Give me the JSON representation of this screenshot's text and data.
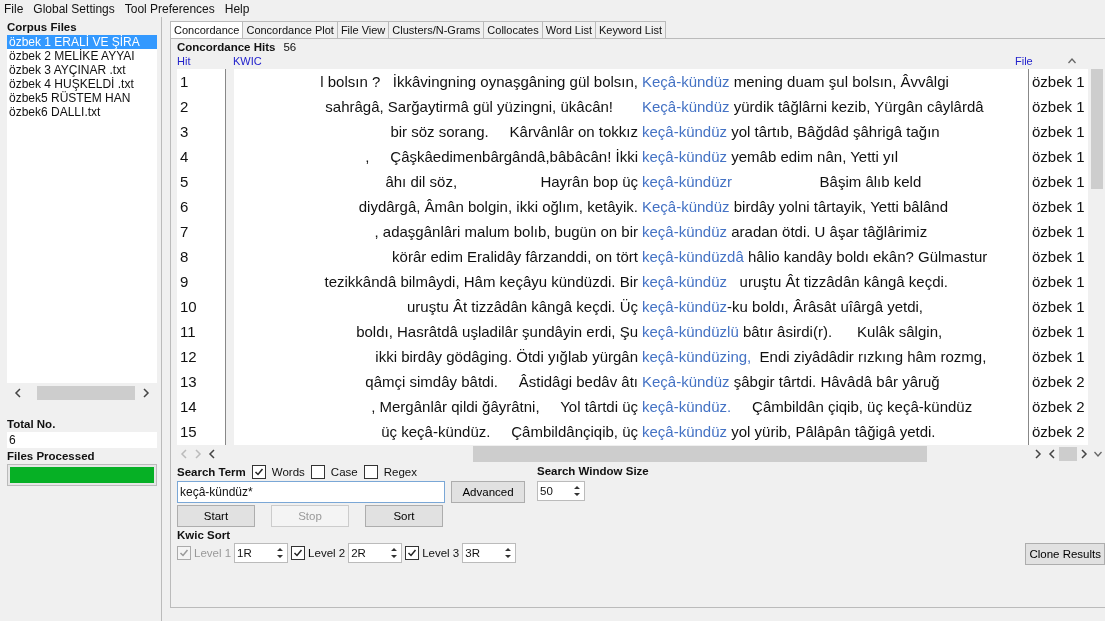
{
  "menu": [
    "File",
    "Global Settings",
    "Tool Preferences",
    "Help"
  ],
  "corpus": {
    "title": "Corpus Files",
    "files": [
      {
        "name": "özbek 1 ERALİ VE ŞİRA",
        "selected": true
      },
      {
        "name": "özbek 2 MELİKE AYYAI",
        "selected": false
      },
      {
        "name": "özbek 3 AYÇINAR .txt",
        "selected": false
      },
      {
        "name": "özbek 4 HUŞKELDİ .txt",
        "selected": false
      },
      {
        "name": "özbek5 RÜSTEM HAN",
        "selected": false
      },
      {
        "name": "özbek6 DALLI.txt",
        "selected": false
      }
    ],
    "total_label": "Total No.",
    "total": "6",
    "processed_label": "Files Processed",
    "progress": {
      "level": 1
    }
  },
  "tabs": [
    {
      "label": "Concordance",
      "selected": true
    },
    {
      "label": "Concordance Plot",
      "selected": false
    },
    {
      "label": "File View",
      "selected": false
    },
    {
      "label": "Clusters/N-Grams",
      "selected": false
    },
    {
      "label": "Collocates",
      "selected": false
    },
    {
      "label": "Word List",
      "selected": false
    },
    {
      "label": "Keyword List",
      "selected": false
    }
  ],
  "hits_label": "Concordance Hits",
  "hits": "56",
  "columns": {
    "hit": "Hit",
    "kwic": "KWIC",
    "file": "File"
  },
  "rows": [
    {
      "hit": "1",
      "left": "l bolsın ?   İkkâvingning oynaşgâning gül bolsın,",
      "key": "Keçâ-kündüz",
      "right": " mening duam şul bolsın, Âvvâlgi",
      "file": "özbek 1"
    },
    {
      "hit": "2",
      "left": "sahrâgâ, Sarğaytirmâ gül yüzingni, ükâcân!      ",
      "key": "Keçâ-kündüz",
      "right": " yürdik tâğlârni kezib, Yürgân câylârdâ",
      "file": "özbek 1"
    },
    {
      "hit": "3",
      "left": "bir söz sorang.     Kârvânlâr on tokkız",
      "key": "keçâ-kündüz",
      "right": " yol târtıb, Bâğdâd şâhrigâ tağın",
      "file": "özbek 1"
    },
    {
      "hit": "4",
      "left": ",     Çâşkâedimenbârgândâ,bâbâcân! İkki",
      "key": "keçâ-kündüz",
      "right": " yemâb edim nân, Yetti yıl",
      "file": "özbek 1"
    },
    {
      "hit": "5",
      "left": "âhı dil söz,                    Hayrân bop üç",
      "key": "keçâ-kündüzr",
      "right": "                     Bâşim âlıb keld",
      "file": "özbek 1"
    },
    {
      "hit": "6",
      "left": "diydârgâ, Âmân bolgin, ikki oğlım, ketâyik.",
      "key": "Keçâ-kündüz",
      "right": " birdây yolni târtayik, Yetti bâlând",
      "file": "özbek 1"
    },
    {
      "hit": "7",
      "left": ", adaşgânlâri malum bolıb, bugün on bir",
      "key": "keçâ-kündüz",
      "right": " aradan ötdi. U âşar tâğlârimiz",
      "file": "özbek 1"
    },
    {
      "hit": "8",
      "left": "körâr edim Eralidây fârzanddi, on tört",
      "key": "keçâ-kündüzdâ",
      "right": " hâlio kandây boldı ekân? Gülmastur",
      "file": "özbek 1"
    },
    {
      "hit": "9",
      "left": "tezikkândâ bilmâydi, Hâm keçâyu kündüzdi. Bir",
      "key": "keçâ-kündüz",
      "right": "   uruştu Ât tizzâdân kângâ keçdi.",
      "file": "özbek 1"
    },
    {
      "hit": "10",
      "left": "uruştu Ât tizzâdân kângâ keçdi. Üç",
      "key": "keçâ-kündüz",
      "right": "-ku boldı, Ârâsât uîârgâ yetdi,",
      "file": "özbek 1"
    },
    {
      "hit": "11",
      "left": "boldı, Hasrâtdâ uşladilâr şundâyin erdi, Şu",
      "key": "keçâ-kündüzlü",
      "right": " bâtır âsirdi(r).      Kulâk sâlgin,",
      "file": "özbek 1"
    },
    {
      "hit": "12",
      "left": "ikki birdây gödâging. Ötdi yığlab yürgân",
      "key": "keçâ-kündüzing,",
      "right": "  Endi ziyâdâdir rızkıng hâm rozmg,",
      "file": "özbek 1"
    },
    {
      "hit": "13",
      "left": "qâmçi simdây bâtdi.     Âstidâgi bedâv âtı",
      "key": "Keçâ-kündüz",
      "right": " şâbgir târtdi. Hâvâdâ bâr yâruğ",
      "file": "özbek 2"
    },
    {
      "hit": "14",
      "left": ", Mergânlâr qildi ğâyrâtni,     Yol târtdi üç",
      "key": "keçâ-kündüz.",
      "right": "     Çâmbildân çiqib, üç keçâ-kündüz",
      "file": "özbek 2"
    },
    {
      "hit": "15",
      "left": "üç keçâ-kündüz.     Çâmbildânçiqib, üç",
      "key": "keçâ-kündüz",
      "right": " yol yürib, Pâlâpân tâğigâ yetdi.",
      "file": "özbek 2"
    }
  ],
  "search": {
    "label": "Search Term",
    "options": [
      {
        "label": "Words",
        "checked": true
      },
      {
        "label": "Case",
        "checked": false
      },
      {
        "label": "Regex",
        "checked": false
      }
    ],
    "value": "keçâ-kündüz*",
    "advanced": "Advanced",
    "window_label": "Search Window Size",
    "window_size": "50"
  },
  "actions": [
    {
      "label": "Start",
      "disabled": false
    },
    {
      "label": "Stop",
      "disabled": true
    },
    {
      "label": "Sort",
      "disabled": false
    }
  ],
  "kwic_sort": {
    "label": "Kwic Sort",
    "levels": [
      {
        "label": "Level 1",
        "value": "1R",
        "checked": true,
        "disabled": true
      },
      {
        "label": "Level 2",
        "value": "2R",
        "checked": true,
        "disabled": false
      },
      {
        "label": "Level 3",
        "value": "3R",
        "checked": true,
        "disabled": false
      }
    ]
  },
  "clone": "Clone Results"
}
